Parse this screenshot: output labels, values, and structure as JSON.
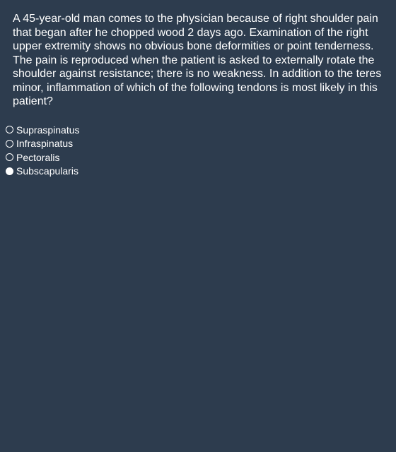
{
  "question": {
    "text": "A 45-year-old man comes to the physician because of right shoulder pain that began after he chopped wood 2 days ago. Examination of the right upper extremity shows no obvious bone deformities or point tenderness. The pain is reproduced when the patient is asked to externally rotate the shoulder against resistance; there is no weakness. In addition to the teres minor, inflammation of which of the following tendons is most likely in this patient?"
  },
  "options": [
    {
      "label": "Supraspinatus",
      "selected": false
    },
    {
      "label": "Infraspinatus",
      "selected": false
    },
    {
      "label": "Pectoralis",
      "selected": false
    },
    {
      "label": "Subscapularis",
      "selected": true
    }
  ],
  "colors": {
    "background": "#2d3c4e",
    "text": "#ffffff"
  }
}
